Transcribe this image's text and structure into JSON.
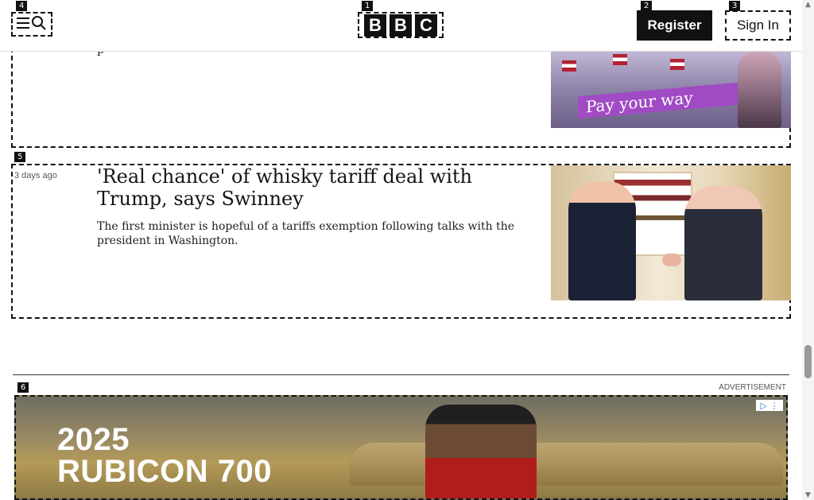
{
  "header": {
    "markers": [
      "4",
      "1",
      "2",
      "3"
    ],
    "logo_letters": [
      "B",
      "B",
      "C"
    ],
    "register_label": "Register",
    "sign_in_label": "Sign In"
  },
  "articles": [
    {
      "marker": "",
      "time": "",
      "headline": "",
      "summary": "p",
      "image_banner": "Pay your way"
    },
    {
      "marker": "5",
      "time": "3 days ago",
      "headline": "'Real chance' of whisky tariff deal with Trump, says Swinney",
      "summary": "The first minister is hopeful of a tariffs exemption following talks with the president in Washington."
    }
  ],
  "advertisement": {
    "marker": "6",
    "label": "ADVERTISEMENT",
    "heading_line1": "2025",
    "heading_line2": "RUBICON 700"
  },
  "colors": {
    "accent": "#111111",
    "purple_banner": "#a04bc4"
  },
  "icons": {
    "menu": "menu-icon",
    "search": "search-icon",
    "ad_choices": "ad-choices-icon",
    "scroll_up": "chevron-up-icon",
    "scroll_down": "chevron-down-icon"
  }
}
